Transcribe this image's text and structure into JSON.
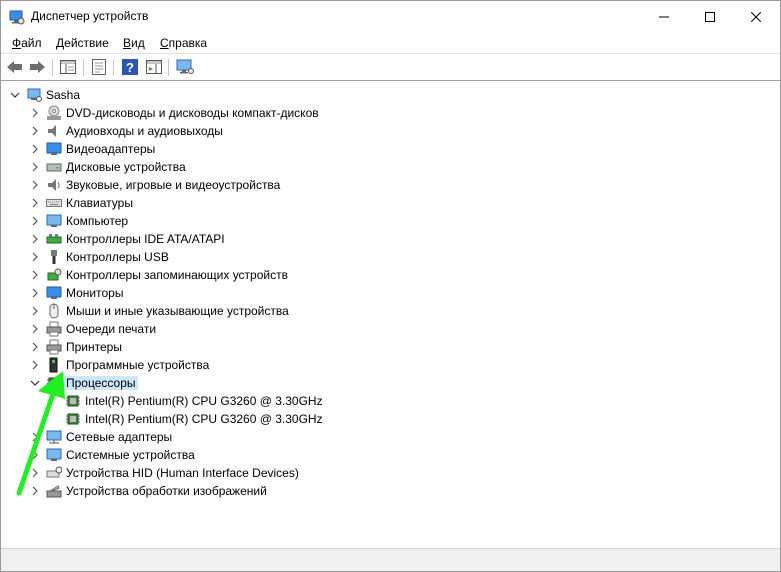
{
  "window": {
    "title": "Диспетчер устройств"
  },
  "menu": [
    {
      "pre": "",
      "u": "Ф",
      "post": "айл"
    },
    {
      "pre": "",
      "u": "Д",
      "post": "ействие"
    },
    {
      "pre": "",
      "u": "В",
      "post": "ид"
    },
    {
      "pre": "",
      "u": "С",
      "post": "правка"
    }
  ],
  "tree": {
    "root": "Sasha",
    "categories": [
      "DVD-дисководы и дисководы компакт-дисков",
      "Аудиовходы и аудиовыходы",
      "Видеоадаптеры",
      "Дисковые устройства",
      "Звуковые, игровые и видеоустройства",
      "Клавиатуры",
      "Компьютер",
      "Контроллеры IDE ATA/ATAPI",
      "Контроллеры USB",
      "Контроллеры запоминающих устройств",
      "Мониторы",
      "Мыши и иные указывающие устройства",
      "Очереди печати",
      "Принтеры",
      "Программные устройства",
      "Процессоры",
      "Сетевые адаптеры",
      "Системные устройства",
      "Устройства HID (Human Interface Devices)",
      "Устройства обработки изображений"
    ],
    "processors": [
      "Intel(R) Pentium(R) CPU G3260 @ 3.30GHz",
      "Intel(R) Pentium(R) CPU G3260 @ 3.30GHz"
    ]
  },
  "colors": {
    "selection": "#cce8ff",
    "annotation_arrow": "#22ee22"
  }
}
